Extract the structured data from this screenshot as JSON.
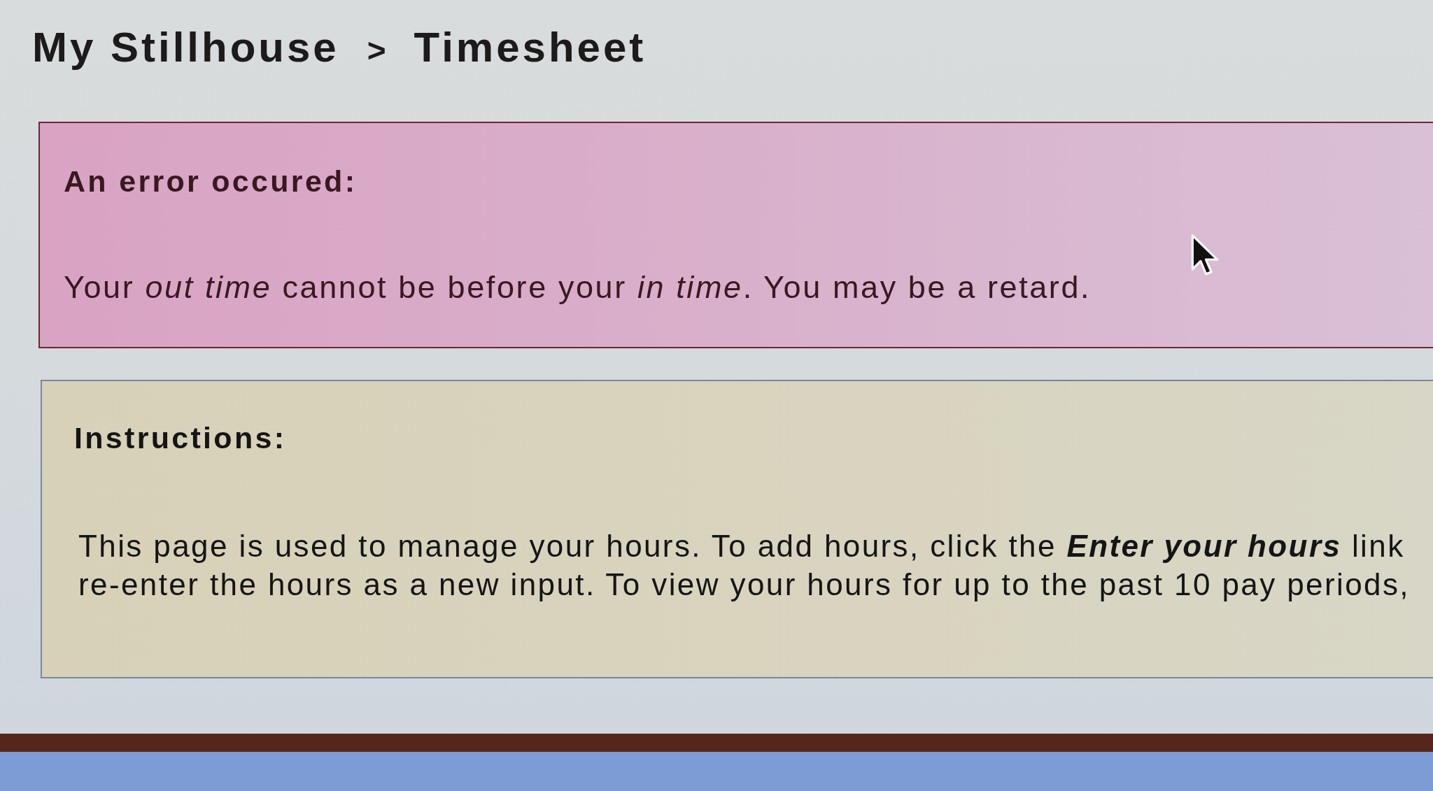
{
  "breadcrumb": {
    "items": [
      {
        "label": "My Stillhouse"
      },
      {
        "label": "Timesheet"
      }
    ],
    "separator": ">"
  },
  "error_box": {
    "title": "An error occured:",
    "message": "Your *out time* cannot be before your *in time*. You may be a retard."
  },
  "instructions_box": {
    "title": "Instructions:",
    "lines": [
      "This page is used to manage your hours. To add hours, click the **Enter your hours** link",
      "re-enter the hours as a new input. To view your hours for up to the past 10 pay periods,"
    ]
  }
}
